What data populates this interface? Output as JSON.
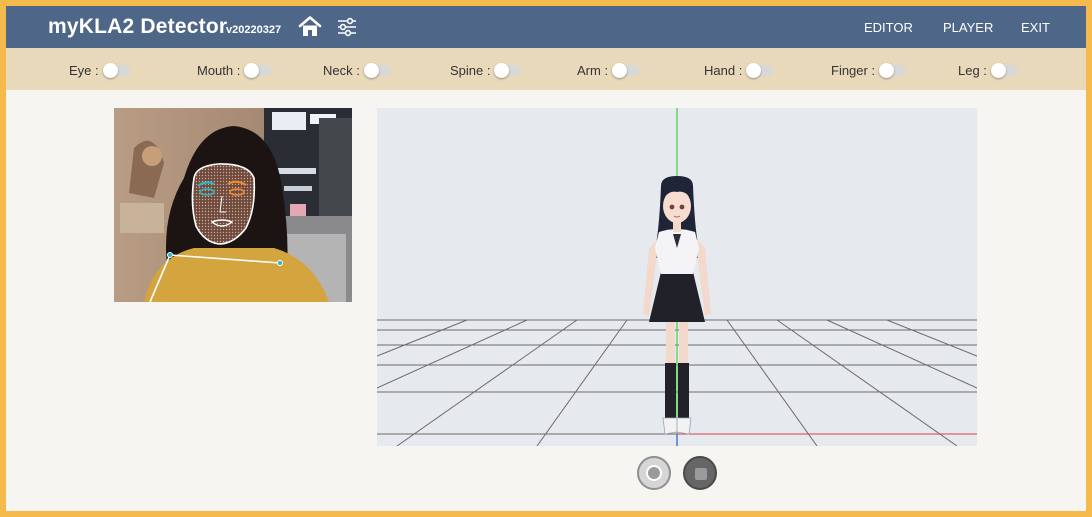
{
  "header": {
    "title": "myKLA2 Detector",
    "version": "v20220327",
    "nav": [
      {
        "label": "EDITOR"
      },
      {
        "label": "PLAYER"
      },
      {
        "label": "EXIT"
      }
    ]
  },
  "toggles": [
    {
      "label": "Eye :",
      "on": false
    },
    {
      "label": "Mouth :",
      "on": false
    },
    {
      "label": "Neck :",
      "on": false
    },
    {
      "label": "Spine :",
      "on": false
    },
    {
      "label": "Arm :",
      "on": false
    },
    {
      "label": "Hand :",
      "on": false
    },
    {
      "label": "Finger :",
      "on": false
    },
    {
      "label": "Leg :",
      "on": false
    }
  ],
  "icons": {
    "home": "home-icon",
    "settings": "sliders-icon",
    "record": "record-icon",
    "stop": "stop-icon"
  },
  "colors": {
    "header_bg": "#4e6688",
    "toggle_bar_bg": "#e8d9bb",
    "frame_border": "#f6b94b",
    "x_axis": "#e04040",
    "y_axis": "#40d040"
  }
}
